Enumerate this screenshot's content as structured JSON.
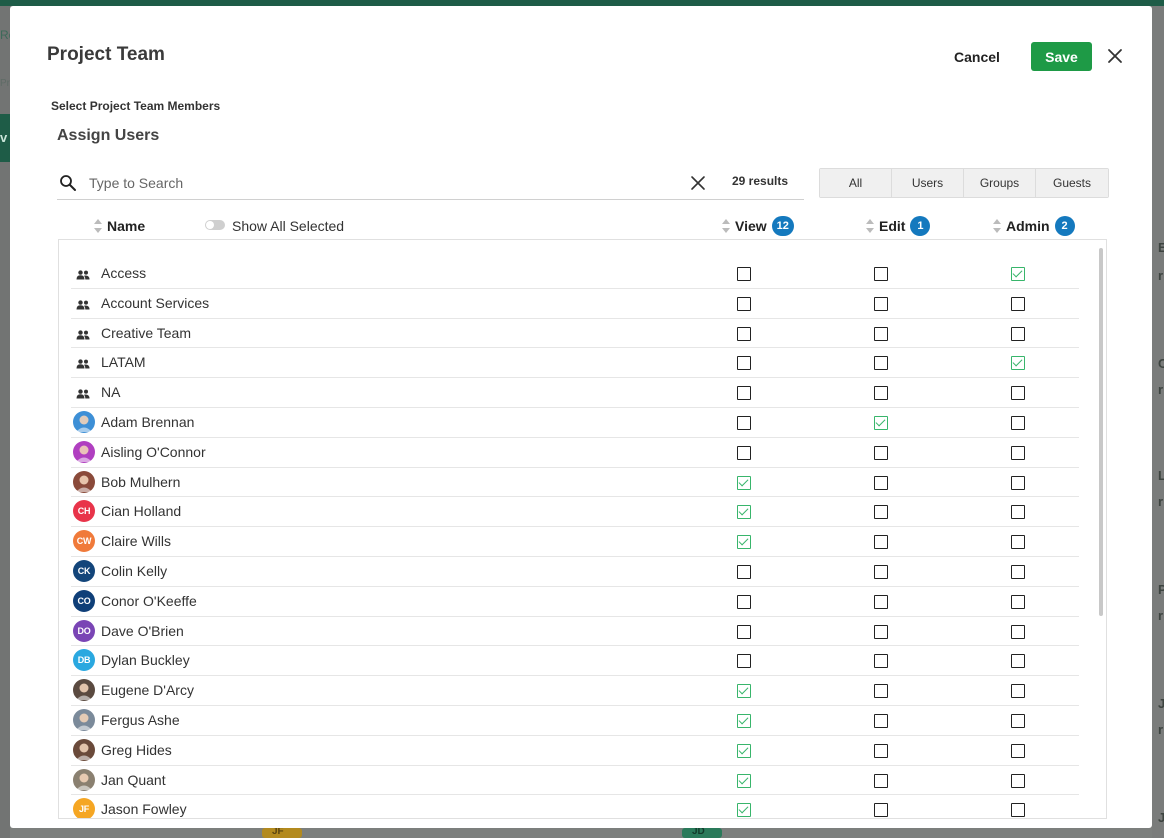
{
  "background": {
    "left_fragments": [
      "Re",
      "Pro",
      "v"
    ],
    "right_fragments": [
      "E",
      "r",
      "C",
      "r",
      "L",
      "r",
      "P",
      "r",
      "J",
      "r",
      "J"
    ],
    "bottom_chips": [
      "JF",
      "JD"
    ]
  },
  "modal": {
    "title": "Project Team",
    "cancel_label": "Cancel",
    "save_label": "Save",
    "section_label": "Select Project Team Members",
    "assign_title": "Assign Users",
    "search": {
      "placeholder": "Type to Search",
      "value": ""
    },
    "results": "29 results",
    "filters": [
      "All",
      "Users",
      "Groups",
      "Guests"
    ],
    "columns": {
      "name": "Name",
      "show_all_selected": "Show All Selected",
      "view": "View",
      "view_count": "12",
      "edit": "Edit",
      "edit_count": "1",
      "admin": "Admin",
      "admin_count": "2"
    },
    "colors": {
      "save": "#1e9a46",
      "badge": "#1479be",
      "check": "#38b56b"
    },
    "rows": [
      {
        "name": "Access",
        "type": "group",
        "view": false,
        "edit": false,
        "admin": true
      },
      {
        "name": "Account Services",
        "type": "group",
        "view": false,
        "edit": false,
        "admin": false
      },
      {
        "name": "Creative Team",
        "type": "group",
        "view": false,
        "edit": false,
        "admin": false
      },
      {
        "name": "LATAM",
        "type": "group",
        "view": false,
        "edit": false,
        "admin": true
      },
      {
        "name": "NA",
        "type": "group",
        "view": false,
        "edit": false,
        "admin": false
      },
      {
        "name": "Adam Brennan",
        "type": "photo",
        "color": "#3d8fd6",
        "view": false,
        "edit": true,
        "admin": false
      },
      {
        "name": "Aisling O'Connor",
        "type": "photo",
        "color": "#b03fc0",
        "view": false,
        "edit": false,
        "admin": false
      },
      {
        "name": "Bob Mulhern",
        "type": "photo",
        "color": "#8a4a3a",
        "view": true,
        "edit": false,
        "admin": false
      },
      {
        "name": "Cian Holland",
        "type": "initials",
        "initials": "CH",
        "color": "#e8344a",
        "view": true,
        "edit": false,
        "admin": false
      },
      {
        "name": "Claire Wills",
        "type": "initials",
        "initials": "CW",
        "color": "#f07a3a",
        "view": true,
        "edit": false,
        "admin": false
      },
      {
        "name": "Colin Kelly",
        "type": "initials",
        "initials": "CK",
        "color": "#13457a",
        "view": false,
        "edit": false,
        "admin": false
      },
      {
        "name": "Conor O'Keeffe",
        "type": "initials",
        "initials": "CO",
        "color": "#0f3f78",
        "view": false,
        "edit": false,
        "admin": false
      },
      {
        "name": "Dave O'Brien",
        "type": "initials",
        "initials": "DO",
        "color": "#7a45b5",
        "view": false,
        "edit": false,
        "admin": false
      },
      {
        "name": "Dylan Buckley",
        "type": "initials",
        "initials": "DB",
        "color": "#2aa8e0",
        "view": false,
        "edit": false,
        "admin": false
      },
      {
        "name": "Eugene D'Arcy",
        "type": "photo",
        "color": "#5a4a40",
        "view": true,
        "edit": false,
        "admin": false
      },
      {
        "name": "Fergus Ashe",
        "type": "photo",
        "color": "#7b8a9a",
        "view": true,
        "edit": false,
        "admin": false
      },
      {
        "name": "Greg Hides",
        "type": "photo",
        "color": "#6a4a3a",
        "view": true,
        "edit": false,
        "admin": false
      },
      {
        "name": "Jan Quant",
        "type": "photo",
        "color": "#8a8070",
        "view": true,
        "edit": false,
        "admin": false
      },
      {
        "name": "Jason Fowley",
        "type": "initials",
        "initials": "JF",
        "color": "#f5a623",
        "view": true,
        "edit": false,
        "admin": false
      }
    ]
  }
}
